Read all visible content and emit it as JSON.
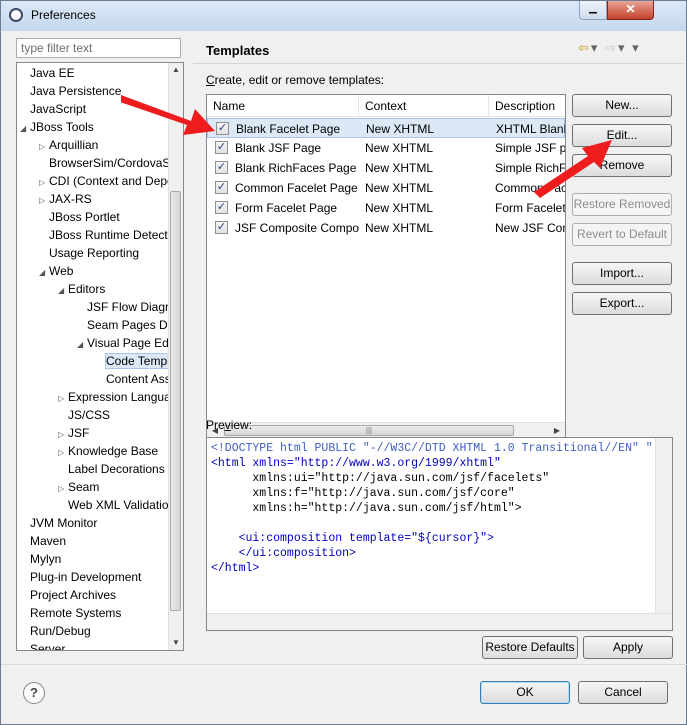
{
  "window": {
    "title": "Preferences",
    "minimize_label": "▁",
    "close_label": "✕"
  },
  "filter": {
    "placeholder": "type filter text"
  },
  "tree": [
    {
      "label": "Java EE",
      "indent": 0,
      "toggle": ""
    },
    {
      "label": "Java Persistence",
      "indent": 0,
      "toggle": ""
    },
    {
      "label": "JavaScript",
      "indent": 0,
      "toggle": ""
    },
    {
      "label": "JBoss Tools",
      "indent": 0,
      "toggle": "◢"
    },
    {
      "label": "Arquillian",
      "indent": 1,
      "toggle": "▷"
    },
    {
      "label": "BrowserSim/CordovaSim",
      "indent": 1,
      "toggle": ""
    },
    {
      "label": "CDI (Context and Dependency",
      "indent": 1,
      "toggle": "▷"
    },
    {
      "label": "JAX-RS",
      "indent": 1,
      "toggle": "▷"
    },
    {
      "label": "JBoss Portlet",
      "indent": 1,
      "toggle": ""
    },
    {
      "label": "JBoss Runtime Detection",
      "indent": 1,
      "toggle": ""
    },
    {
      "label": "Usage Reporting",
      "indent": 1,
      "toggle": ""
    },
    {
      "label": "Web",
      "indent": 1,
      "toggle": "◢"
    },
    {
      "label": "Editors",
      "indent": 2,
      "toggle": "◢"
    },
    {
      "label": "JSF Flow Diagram",
      "indent": 3,
      "toggle": ""
    },
    {
      "label": "Seam Pages Diagram",
      "indent": 3,
      "toggle": ""
    },
    {
      "label": "Visual Page Editor",
      "indent": 3,
      "toggle": "◢"
    },
    {
      "label": "Code Templates",
      "indent": 4,
      "toggle": "",
      "selected": true
    },
    {
      "label": "Content Assist",
      "indent": 4,
      "toggle": ""
    },
    {
      "label": "Expression Language",
      "indent": 2,
      "toggle": "▷"
    },
    {
      "label": "JS/CSS",
      "indent": 2,
      "toggle": ""
    },
    {
      "label": "JSF",
      "indent": 2,
      "toggle": "▷"
    },
    {
      "label": "Knowledge Base",
      "indent": 2,
      "toggle": "▷"
    },
    {
      "label": "Label Decorations",
      "indent": 2,
      "toggle": ""
    },
    {
      "label": "Seam",
      "indent": 2,
      "toggle": "▷"
    },
    {
      "label": "Web XML Validation",
      "indent": 2,
      "toggle": ""
    },
    {
      "label": "JVM Monitor",
      "indent": 0,
      "toggle": ""
    },
    {
      "label": "Maven",
      "indent": 0,
      "toggle": ""
    },
    {
      "label": "Mylyn",
      "indent": 0,
      "toggle": ""
    },
    {
      "label": "Plug-in Development",
      "indent": 0,
      "toggle": ""
    },
    {
      "label": "Project Archives",
      "indent": 0,
      "toggle": ""
    },
    {
      "label": "Remote Systems",
      "indent": 0,
      "toggle": ""
    },
    {
      "label": "Run/Debug",
      "indent": 0,
      "toggle": ""
    },
    {
      "label": "Server",
      "indent": 0,
      "toggle": ""
    }
  ],
  "page": {
    "title": "Templates",
    "section_label_pre": "",
    "section_label_mnemonic": "C",
    "section_label_post": "reate, edit or remove templates:",
    "preview_label_pre": "Pre",
    "preview_label_mnemonic": "v",
    "preview_label_post": "iew:"
  },
  "table": {
    "headers": [
      "Name",
      "Context",
      "Description"
    ],
    "rows": [
      {
        "name": "Blank Facelet Page",
        "context": "New XHTML",
        "description": "XHTML Blank Facelet",
        "checked": true,
        "selected": true
      },
      {
        "name": "Blank JSF Page",
        "context": "New XHTML",
        "description": "Simple JSF page",
        "checked": true
      },
      {
        "name": "Blank RichFaces Page",
        "context": "New XHTML",
        "description": "Simple RichFaces",
        "checked": true
      },
      {
        "name": "Common Facelet Page",
        "context": "New XHTML",
        "description": "Common Facelet",
        "checked": true
      },
      {
        "name": "Form Facelet Page",
        "context": "New XHTML",
        "description": "Form Facelet",
        "checked": true
      },
      {
        "name": "JSF Composite Component",
        "context": "New XHTML",
        "description": "New JSF Composite",
        "checked": true
      }
    ],
    "check_glyph": "✓"
  },
  "buttons": {
    "new": "New...",
    "edit": "Edit...",
    "remove": "Remove",
    "restore_removed": "Restore Removed",
    "revert_to_default": "Revert to Default",
    "import": "Import...",
    "export": "Export...",
    "restore_defaults": "Restore Defaults",
    "apply": "Apply",
    "ok": "OK",
    "cancel": "Cancel"
  },
  "preview": {
    "lines": [
      "<!DOCTYPE html PUBLIC \"-//W3C//DTD XHTML 1.0 Transitional//EN\" \"",
      "<html xmlns=\"http://www.w3.org/1999/xhtml\"",
      "      xmlns:ui=\"http://java.sun.com/jsf/facelets\"",
      "      xmlns:f=\"http://java.sun.com/jsf/core\"",
      "      xmlns:h=\"http://java.sun.com/jsf/html\">",
      "",
      "    <ui:composition template=\"${cursor}\">",
      "    </ui:composition>",
      "</html>"
    ]
  },
  "icons": {
    "help": "?",
    "nav_back": "⇦",
    "nav_fwd": "⇨",
    "nav_menu": "▾",
    "arrow_accent": "#ee1c1c"
  }
}
